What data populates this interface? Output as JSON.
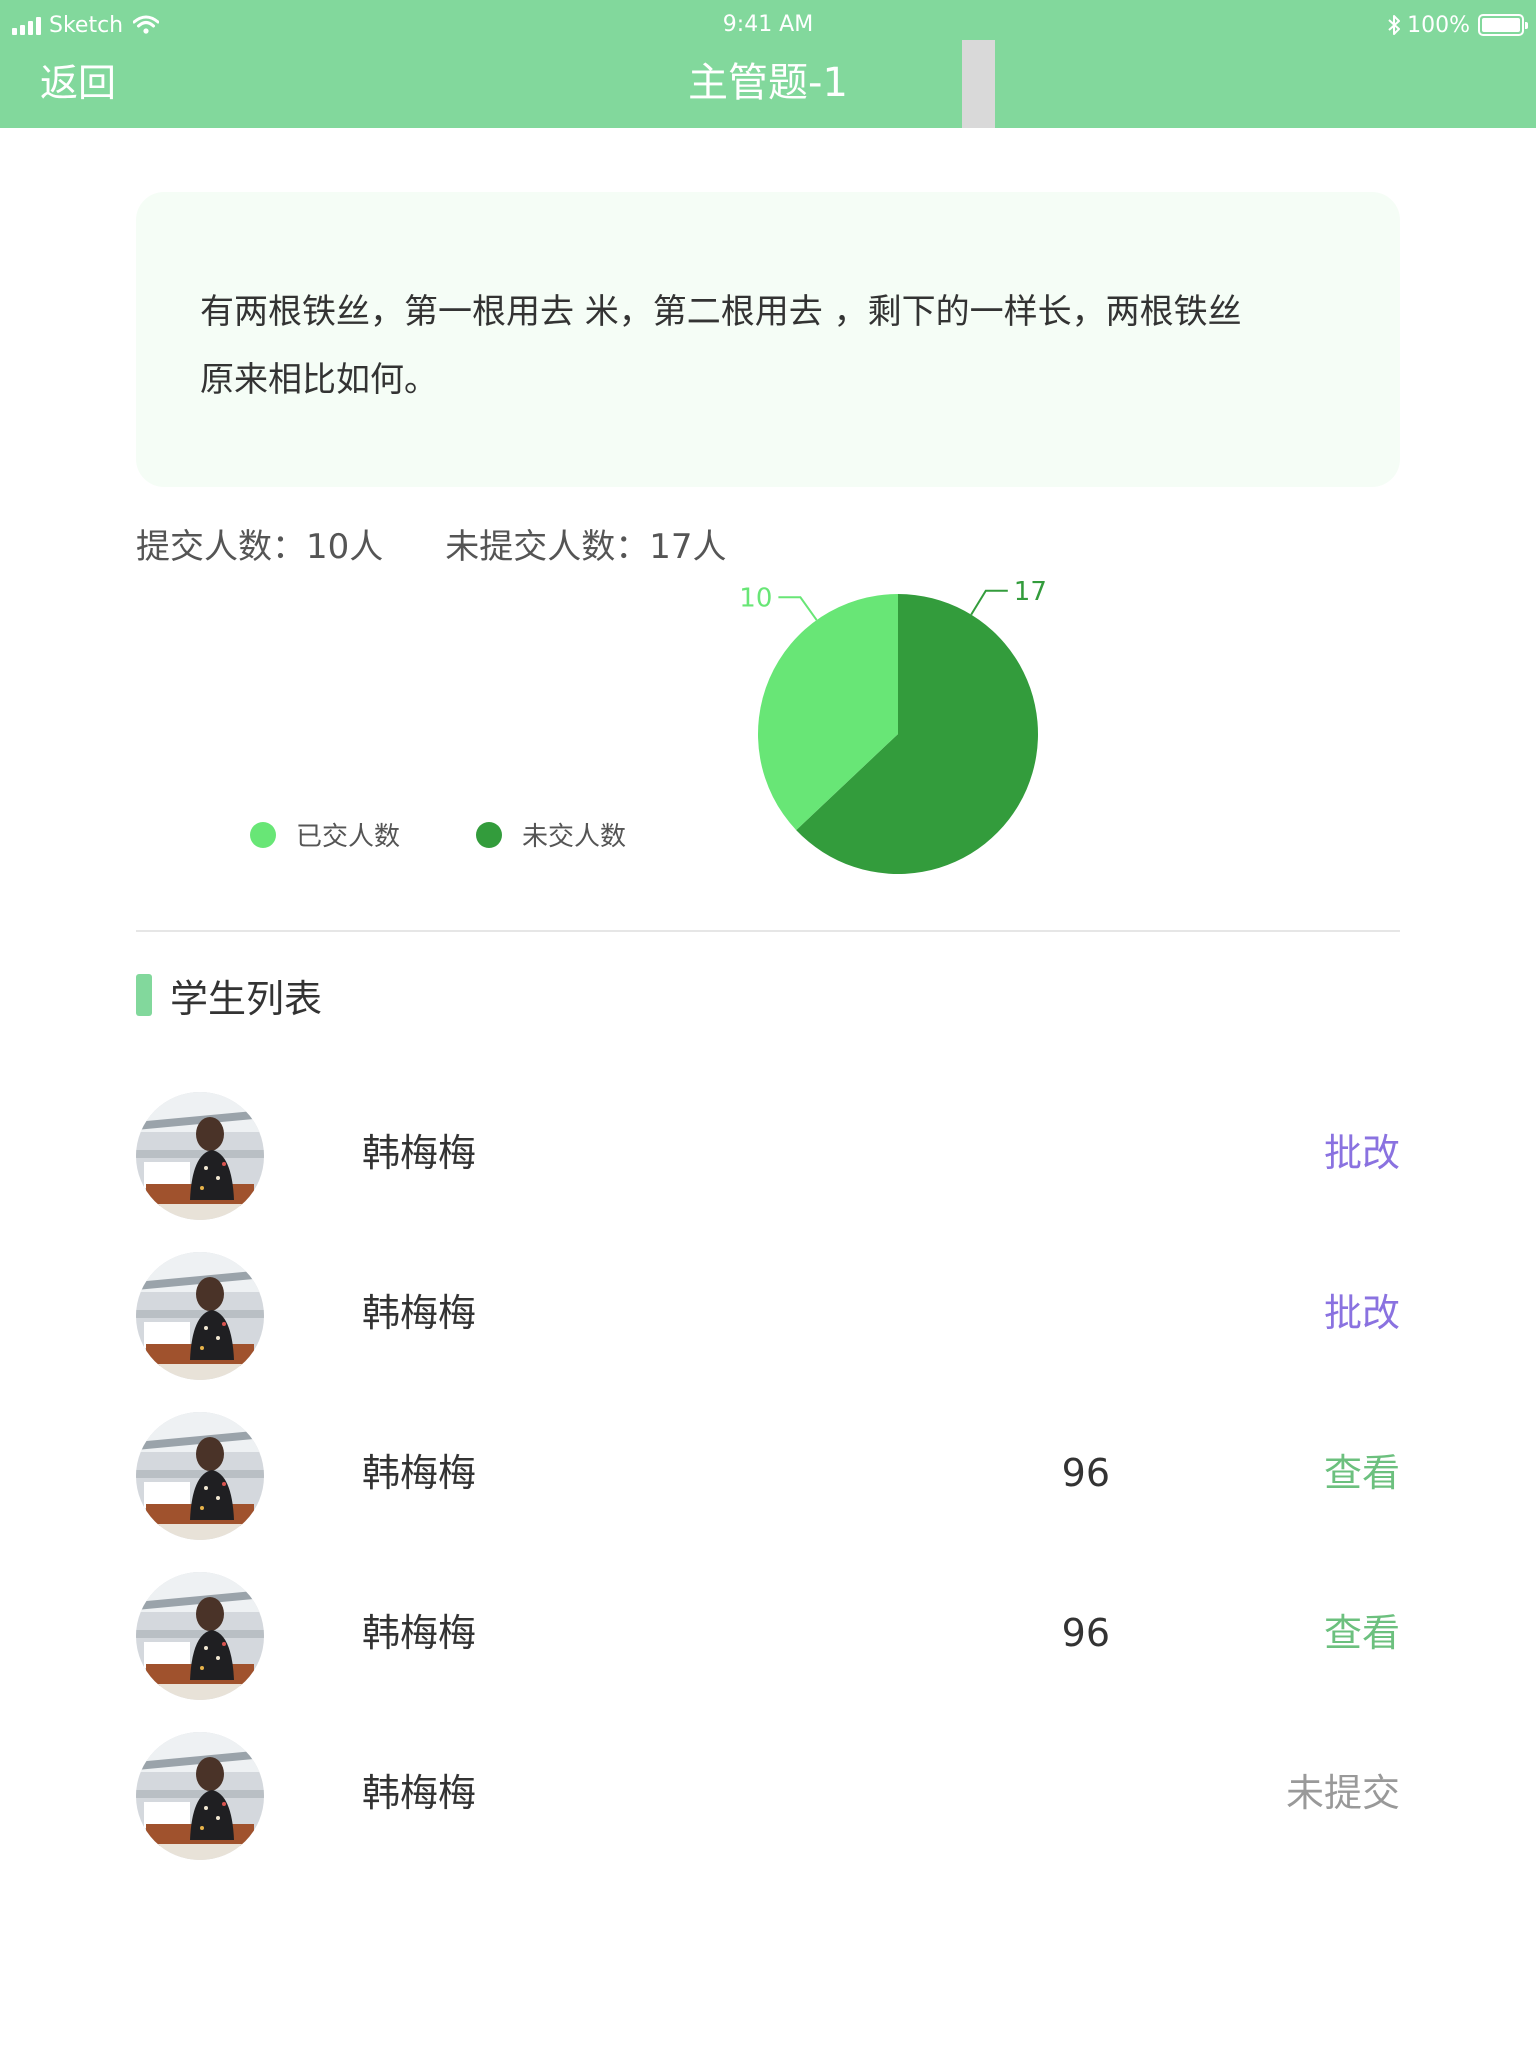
{
  "status_bar": {
    "carrier": "Sketch",
    "time": "9:41 AM",
    "battery": "100%",
    "wifi_icon": "wifi-icon",
    "bluetooth_icon": "bluetooth-icon"
  },
  "header": {
    "back_label": "返回",
    "title": "主管题-1",
    "background_color": "#82d89c"
  },
  "question": {
    "text_line1": "有两根铁丝，第一根用去 米，第二根用去 ，剩下的一样长，两根铁丝",
    "text_line2": "原来相比如何。"
  },
  "stats": {
    "submitted_text": "提交人数：10人",
    "unsubmitted_text": "未提交人数：17人"
  },
  "legend": {
    "submitted_label": "已交人数",
    "unsubmitted_label": "未交人数"
  },
  "chart_data": {
    "type": "pie",
    "categories": [
      "已交人数",
      "未交人数"
    ],
    "values": [
      10,
      17
    ],
    "colors": [
      "#68e676",
      "#339c3c"
    ],
    "data_labels": [
      "10",
      "17"
    ],
    "legend_position": "left"
  },
  "section": {
    "title": "学生列表",
    "accent_color": "#82d89c"
  },
  "students": [
    {
      "name": "韩梅梅",
      "score": "",
      "action": "批改"
    },
    {
      "name": "韩梅梅",
      "score": "",
      "action": "批改"
    },
    {
      "name": "韩梅梅",
      "score": "96",
      "action": "查看"
    },
    {
      "name": "韩梅梅",
      "score": "96",
      "action": "查看"
    },
    {
      "name": "韩梅梅",
      "score": "",
      "action": "未提交"
    }
  ]
}
